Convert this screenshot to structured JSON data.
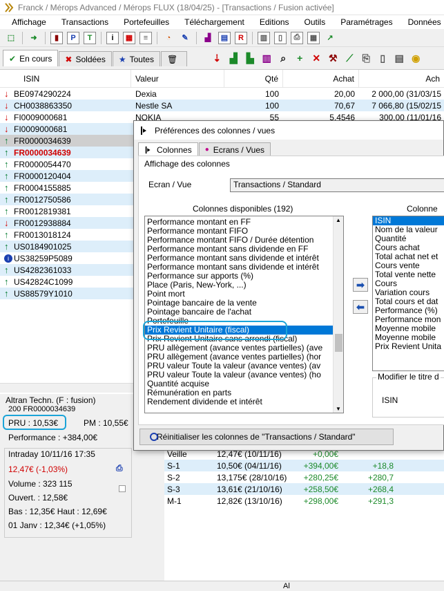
{
  "window": {
    "title": "Franck / Mérops Advanced / Mérops FLUX (18/04/25) - [Transactions / Fusion activée]"
  },
  "menu": [
    "Affichage",
    "Transactions",
    "Portefeuilles",
    "Téléchargement",
    "Editions",
    "Outils",
    "Paramétrages",
    "Données"
  ],
  "tabs": {
    "encours": "En cours",
    "soldees": "Soldées",
    "toutes": "Toutes"
  },
  "grid": {
    "headers": {
      "isin": "ISIN",
      "valeur": "Valeur",
      "qte": "Qté",
      "achat": "Achat",
      "achat2": "Ach"
    },
    "rows": [
      {
        "isin": "BE0974290224",
        "valeur": "Dexia",
        "qte": "100",
        "achat": "20,00",
        "achat2": "2 000,00 (31/03/15",
        "dir": "down"
      },
      {
        "isin": "CH0038863350",
        "valeur": "Nestle SA",
        "qte": "100",
        "achat": "70,67",
        "achat2": "7 066,80 (15/02/15",
        "dir": "down"
      },
      {
        "isin": "FI0009000681",
        "valeur": "NOKIA",
        "qte": "55",
        "achat": "5,4546",
        "achat2": "300,00 (11/01/16",
        "dir": "down"
      },
      {
        "isin": "FI0009000681",
        "valeur": "",
        "qte": "",
        "achat": "",
        "achat2": "",
        "dir": "down"
      },
      {
        "isin": "FR0000034639",
        "valeur": "",
        "qte": "",
        "achat": "",
        "achat2": "",
        "dir": "up"
      },
      {
        "isin": "FR0000034639",
        "valeur": "",
        "qte": "",
        "achat": "",
        "achat2": "",
        "dir": "up",
        "red": true
      },
      {
        "isin": "FR0000054470",
        "valeur": "",
        "qte": "",
        "achat": "",
        "achat2": "",
        "dir": "up"
      },
      {
        "isin": "FR0000120404",
        "valeur": "",
        "qte": "",
        "achat": "",
        "achat2": "",
        "dir": "up"
      },
      {
        "isin": "FR0004155885",
        "valeur": "",
        "qte": "",
        "achat": "",
        "achat2": "",
        "dir": "up"
      },
      {
        "isin": "FR0012750586",
        "valeur": "",
        "qte": "",
        "achat": "",
        "achat2": "",
        "dir": "up"
      },
      {
        "isin": "FR0012819381",
        "valeur": "",
        "qte": "",
        "achat": "",
        "achat2": "",
        "dir": "up"
      },
      {
        "isin": "FR0012938884",
        "valeur": "",
        "qte": "",
        "achat": "",
        "achat2": "",
        "dir": "down"
      },
      {
        "isin": "FR0013018124",
        "valeur": "",
        "qte": "",
        "achat": "",
        "achat2": "",
        "dir": "up"
      },
      {
        "isin": "US0184901025",
        "valeur": "",
        "qte": "",
        "achat": "",
        "achat2": "",
        "dir": "up"
      },
      {
        "isin": "US38259P5089",
        "valeur": "",
        "qte": "",
        "achat": "",
        "achat2": "",
        "dir": "info"
      },
      {
        "isin": "US4282361033",
        "valeur": "",
        "qte": "",
        "achat": "",
        "achat2": "",
        "dir": "up"
      },
      {
        "isin": "US42824C1099",
        "valeur": "",
        "qte": "",
        "achat": "",
        "achat2": "",
        "dir": "up"
      },
      {
        "isin": "US88579Y1010",
        "valeur": "",
        "qte": "",
        "achat": "",
        "achat2": "",
        "dir": "up"
      }
    ]
  },
  "leftpanel": {
    "name": "Altran Techn. (F : fusion)",
    "line2": "200 FR0000034639",
    "pru": "PRU : 10,53€",
    "pm": "PM : 10,55€",
    "performance": "Performance : +384,00€",
    "intraday": "Intraday 10/11/16 17:35",
    "price": "12,47€ (-1,03%)",
    "volume": "Volume : 323 115",
    "ouvert": "Ouvert. : 12,58€",
    "bashaut": "Bas : 12,35€ Haut : 12,69€",
    "janv": "01 Janv : 12,34€ (+1,05%)"
  },
  "bottomgrid": [
    {
      "c1": "Veille",
      "c2": "12,47€ (10/11/16)",
      "c3": "+0,00€",
      "c4": "",
      "c5": ""
    },
    {
      "c1": "S-1",
      "c2": "10,50€ (04/11/16)",
      "c3": "+394,00€",
      "c4": "+18,8",
      "c5": ""
    },
    {
      "c1": "S-2",
      "c2": "13,175€ (28/10/16)",
      "c3": "+280,25€",
      "c4": "+280,7",
      "c5": ""
    },
    {
      "c1": "S-3",
      "c2": "13,61€ (21/10/16)",
      "c3": "+258,50€",
      "c4": "+268,4",
      "c5": ""
    },
    {
      "c1": "M-1",
      "c2": "12,82€ (13/10/16)",
      "c3": "+298,00€",
      "c4": "+291,3",
      "c5": ""
    }
  ],
  "statusbar": {
    "text": "Al"
  },
  "dialog": {
    "title": "Préférences des colonnes / vues",
    "tab1": "Colonnes",
    "tab2": "Ecrans / Vues",
    "section": "Affichage des colonnes",
    "ecran_label": "Ecran / Vue",
    "ecran_value": "Transactions / Standard",
    "available_title": "Colonnes disponibles (192)",
    "available": [
      "Performance montant en FF",
      "Performance montant FIFO",
      "Performance montant FIFO / Durée détention",
      "Performance montant sans dividende en FF",
      "Performance montant sans dividende et intérêt",
      "Performance montant sans dividende et intérêt",
      "Performance sur apports (%)",
      "Place (Paris, New-York, ...)",
      "Point mort",
      "Pointage bancaire de la vente",
      "Pointage bancaire de l'achat",
      "Portefeuille",
      "Prix Revient Unitaire (fiscal)",
      "Prix Revient Unitaire sans arrondi (fiscal)",
      "PRU allègement (avance ventes partielles) (ave",
      "PRU allègement (avance ventes partielles) (hor",
      "PRU valeur Toute la valeur (avance ventes) (av",
      "PRU valeur Toute la valeur (avance ventes) (ho",
      "Quantité acquise",
      "Rémunération en parts",
      "Rendement dividende et intérêt"
    ],
    "selected_title": "Colonne",
    "selected": [
      "ISIN",
      "Nom de la valeur",
      "Quantité",
      "Cours achat",
      "Total achat net et",
      "Cours vente",
      "Total vente nette",
      "Cours",
      "Variation cours",
      "Total cours et dat",
      "Performance (%)",
      "Performance mon",
      "Moyenne mobile",
      "Moyenne mobile",
      "Prix Revient Unita"
    ],
    "modify_title": "Modifier le titre d",
    "modify_value": "ISIN",
    "reset": "Réinitialiser les colonnes de \"Transactions / Standard\""
  }
}
